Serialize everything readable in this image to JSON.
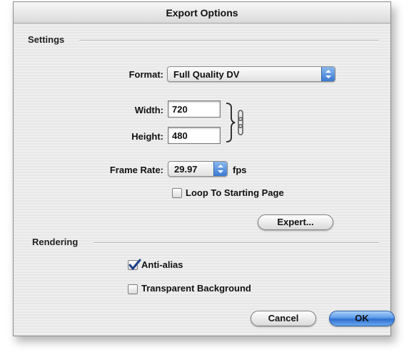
{
  "window": {
    "title": "Export Options"
  },
  "settings": {
    "group_label": "Settings",
    "format": {
      "label": "Format:",
      "value": "Full Quality DV"
    },
    "width": {
      "label": "Width:",
      "value": "720"
    },
    "height": {
      "label": "Height:",
      "value": "480"
    },
    "frame_rate": {
      "label": "Frame Rate:",
      "value": "29.97",
      "unit": "fps"
    },
    "loop": {
      "label": "Loop To Starting Page",
      "checked": false
    },
    "expert_button": "Expert..."
  },
  "rendering": {
    "group_label": "Rendering",
    "anti_alias": {
      "label": "Anti-alias",
      "checked": true
    },
    "transparent_bg": {
      "label": "Transparent Background",
      "checked": false
    }
  },
  "buttons": {
    "cancel": "Cancel",
    "ok": "OK"
  }
}
